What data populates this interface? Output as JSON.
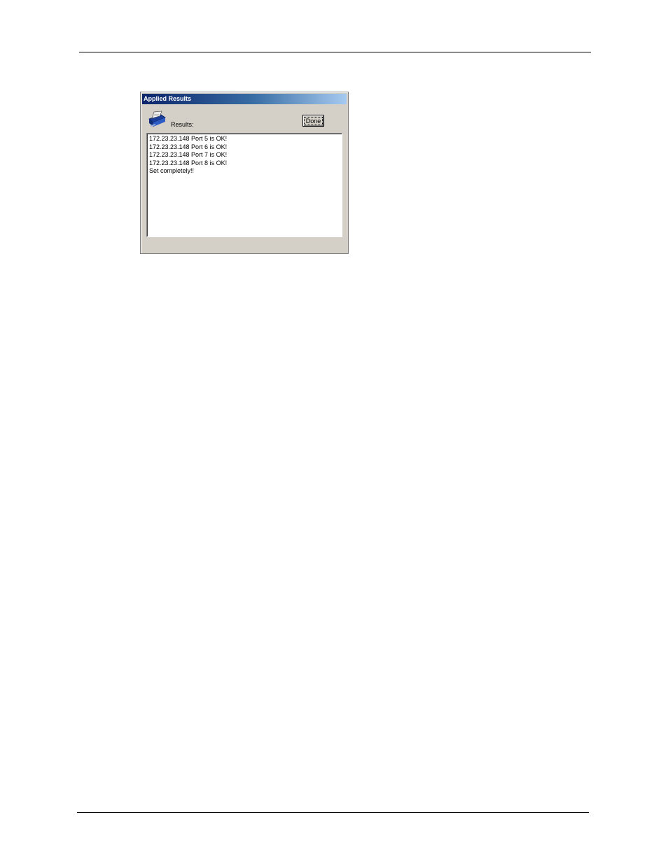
{
  "dialog": {
    "title": "Applied Results",
    "results_label": "Results:",
    "done_label": "Done",
    "icon": "results-document-icon",
    "lines": [
      "172.23.23.148 Port 5 is OK!",
      "172.23.23.148 Port 6 is OK!",
      "172.23.23.148 Port 7 is OK!",
      "172.23.23.148 Port 8 is OK!",
      "Set completely!!"
    ]
  },
  "colors": {
    "title_bar_start": "#0a246a",
    "title_bar_end": "#a6caf0",
    "dialog_face": "#d4d0c8"
  }
}
